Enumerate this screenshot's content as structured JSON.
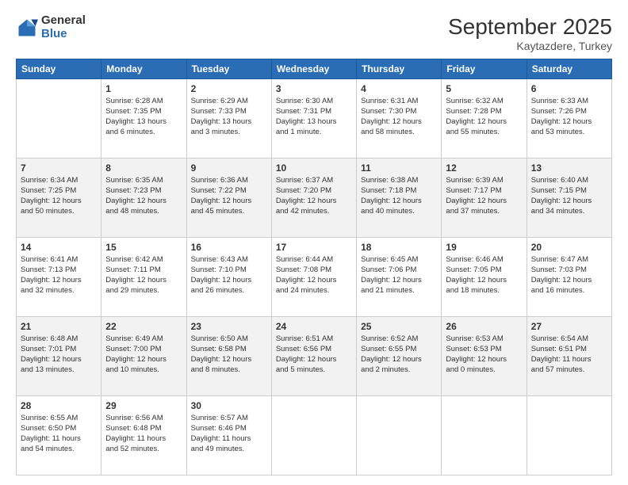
{
  "logo": {
    "general": "General",
    "blue": "Blue"
  },
  "header": {
    "month": "September 2025",
    "location": "Kaytazdere, Turkey"
  },
  "days": [
    "Sunday",
    "Monday",
    "Tuesday",
    "Wednesday",
    "Thursday",
    "Friday",
    "Saturday"
  ],
  "weeks": [
    [
      {
        "day": "",
        "content": ""
      },
      {
        "day": "1",
        "content": "Sunrise: 6:28 AM\nSunset: 7:35 PM\nDaylight: 13 hours\nand 6 minutes."
      },
      {
        "day": "2",
        "content": "Sunrise: 6:29 AM\nSunset: 7:33 PM\nDaylight: 13 hours\nand 3 minutes."
      },
      {
        "day": "3",
        "content": "Sunrise: 6:30 AM\nSunset: 7:31 PM\nDaylight: 13 hours\nand 1 minute."
      },
      {
        "day": "4",
        "content": "Sunrise: 6:31 AM\nSunset: 7:30 PM\nDaylight: 12 hours\nand 58 minutes."
      },
      {
        "day": "5",
        "content": "Sunrise: 6:32 AM\nSunset: 7:28 PM\nDaylight: 12 hours\nand 55 minutes."
      },
      {
        "day": "6",
        "content": "Sunrise: 6:33 AM\nSunset: 7:26 PM\nDaylight: 12 hours\nand 53 minutes."
      }
    ],
    [
      {
        "day": "7",
        "content": "Sunrise: 6:34 AM\nSunset: 7:25 PM\nDaylight: 12 hours\nand 50 minutes."
      },
      {
        "day": "8",
        "content": "Sunrise: 6:35 AM\nSunset: 7:23 PM\nDaylight: 12 hours\nand 48 minutes."
      },
      {
        "day": "9",
        "content": "Sunrise: 6:36 AM\nSunset: 7:22 PM\nDaylight: 12 hours\nand 45 minutes."
      },
      {
        "day": "10",
        "content": "Sunrise: 6:37 AM\nSunset: 7:20 PM\nDaylight: 12 hours\nand 42 minutes."
      },
      {
        "day": "11",
        "content": "Sunrise: 6:38 AM\nSunset: 7:18 PM\nDaylight: 12 hours\nand 40 minutes."
      },
      {
        "day": "12",
        "content": "Sunrise: 6:39 AM\nSunset: 7:17 PM\nDaylight: 12 hours\nand 37 minutes."
      },
      {
        "day": "13",
        "content": "Sunrise: 6:40 AM\nSunset: 7:15 PM\nDaylight: 12 hours\nand 34 minutes."
      }
    ],
    [
      {
        "day": "14",
        "content": "Sunrise: 6:41 AM\nSunset: 7:13 PM\nDaylight: 12 hours\nand 32 minutes."
      },
      {
        "day": "15",
        "content": "Sunrise: 6:42 AM\nSunset: 7:11 PM\nDaylight: 12 hours\nand 29 minutes."
      },
      {
        "day": "16",
        "content": "Sunrise: 6:43 AM\nSunset: 7:10 PM\nDaylight: 12 hours\nand 26 minutes."
      },
      {
        "day": "17",
        "content": "Sunrise: 6:44 AM\nSunset: 7:08 PM\nDaylight: 12 hours\nand 24 minutes."
      },
      {
        "day": "18",
        "content": "Sunrise: 6:45 AM\nSunset: 7:06 PM\nDaylight: 12 hours\nand 21 minutes."
      },
      {
        "day": "19",
        "content": "Sunrise: 6:46 AM\nSunset: 7:05 PM\nDaylight: 12 hours\nand 18 minutes."
      },
      {
        "day": "20",
        "content": "Sunrise: 6:47 AM\nSunset: 7:03 PM\nDaylight: 12 hours\nand 16 minutes."
      }
    ],
    [
      {
        "day": "21",
        "content": "Sunrise: 6:48 AM\nSunset: 7:01 PM\nDaylight: 12 hours\nand 13 minutes."
      },
      {
        "day": "22",
        "content": "Sunrise: 6:49 AM\nSunset: 7:00 PM\nDaylight: 12 hours\nand 10 minutes."
      },
      {
        "day": "23",
        "content": "Sunrise: 6:50 AM\nSunset: 6:58 PM\nDaylight: 12 hours\nand 8 minutes."
      },
      {
        "day": "24",
        "content": "Sunrise: 6:51 AM\nSunset: 6:56 PM\nDaylight: 12 hours\nand 5 minutes."
      },
      {
        "day": "25",
        "content": "Sunrise: 6:52 AM\nSunset: 6:55 PM\nDaylight: 12 hours\nand 2 minutes."
      },
      {
        "day": "26",
        "content": "Sunrise: 6:53 AM\nSunset: 6:53 PM\nDaylight: 12 hours\nand 0 minutes."
      },
      {
        "day": "27",
        "content": "Sunrise: 6:54 AM\nSunset: 6:51 PM\nDaylight: 11 hours\nand 57 minutes."
      }
    ],
    [
      {
        "day": "28",
        "content": "Sunrise: 6:55 AM\nSunset: 6:50 PM\nDaylight: 11 hours\nand 54 minutes."
      },
      {
        "day": "29",
        "content": "Sunrise: 6:56 AM\nSunset: 6:48 PM\nDaylight: 11 hours\nand 52 minutes."
      },
      {
        "day": "30",
        "content": "Sunrise: 6:57 AM\nSunset: 6:46 PM\nDaylight: 11 hours\nand 49 minutes."
      },
      {
        "day": "",
        "content": ""
      },
      {
        "day": "",
        "content": ""
      },
      {
        "day": "",
        "content": ""
      },
      {
        "day": "",
        "content": ""
      }
    ]
  ]
}
